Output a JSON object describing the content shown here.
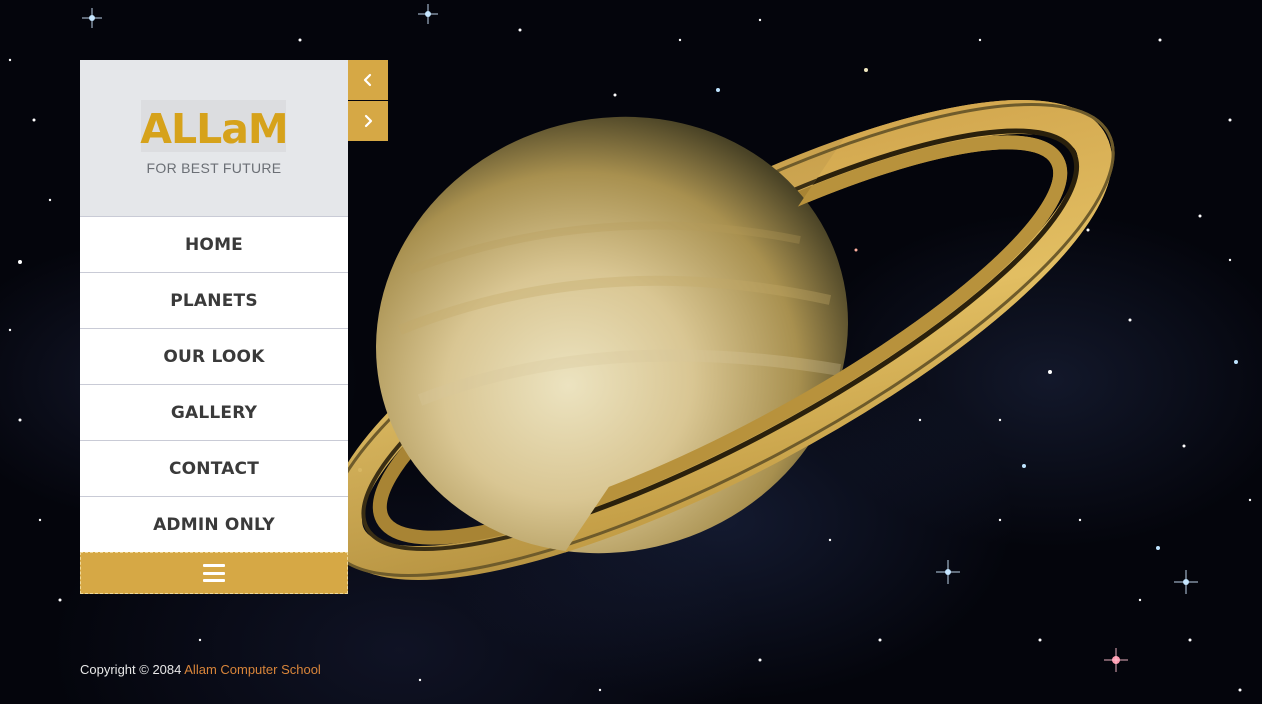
{
  "brand": {
    "logo_text": "ALLaM",
    "tagline": "FOR BEST FUTURE"
  },
  "nav": {
    "items": [
      {
        "label": "HOME"
      },
      {
        "label": "PLANETS"
      },
      {
        "label": "OUR LOOK"
      },
      {
        "label": "GALLERY"
      },
      {
        "label": "CONTACT"
      },
      {
        "label": "ADMIN ONLY"
      }
    ],
    "toggle_icon": "hamburger-menu-icon"
  },
  "slider": {
    "prev_icon": "chevron-left-icon",
    "next_icon": "chevron-right-icon"
  },
  "footer": {
    "copyright_text": "Copyright © 2084",
    "link_text": "Allam Computer School"
  },
  "colors": {
    "accent": "#d6a845",
    "logo": "#d6a21b",
    "footer_link": "#d9853a",
    "brand_bg": "#e5e7ea"
  }
}
